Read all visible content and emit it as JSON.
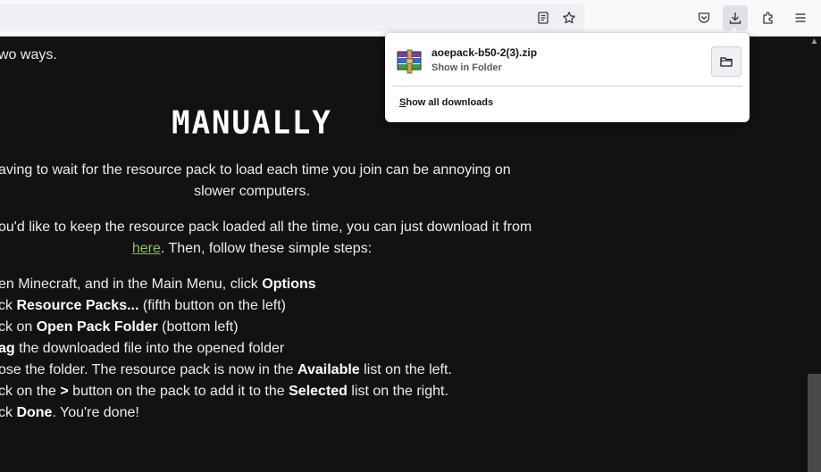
{
  "toolbar": {
    "icons": [
      "reader-view-icon",
      "bookmark-star-icon",
      "pocket-icon",
      "downloads-icon",
      "extensions-icon",
      "menu-icon"
    ]
  },
  "downloads_panel": {
    "file_name": "aoepack-b50-2(3).zip",
    "status": "Show in Folder",
    "show_all_access": "S",
    "show_all_rest": "how all downloads"
  },
  "page": {
    "intro": "wo ways.",
    "heading": "Manually",
    "para1_line1": "aving to wait for the resource pack to load each time you join can be annoying on",
    "para1_line2": "slower computers.",
    "para2_line1": "ou'd like to keep the resource pack loaded all the time, you can just download it from",
    "para2_link": "here",
    "para2_rest": ". Then, follow these simple steps:",
    "steps": [
      {
        "pre": "en Minecraft, and in the Main Menu, click ",
        "b": "Options",
        "post": ""
      },
      {
        "pre": "ck ",
        "b": "Resource Packs...",
        "post": " (fifth button on the left)"
      },
      {
        "pre": "ck on ",
        "b": "Open Pack Folder",
        "post": " (bottom left)"
      },
      {
        "pre": "",
        "b": "ag",
        "post": " the downloaded file into the opened folder"
      },
      {
        "pre": "ose the folder. The resource pack is now in the ",
        "b": "Available",
        "post": " list on the left."
      },
      {
        "pre": "ck on the ",
        "b": ">",
        "post": " button on the pack to add it to the ",
        "b2": "Selected",
        "post2": " list on the right."
      },
      {
        "pre": "ck ",
        "b": "Done",
        "post": ". You're done!"
      }
    ]
  }
}
